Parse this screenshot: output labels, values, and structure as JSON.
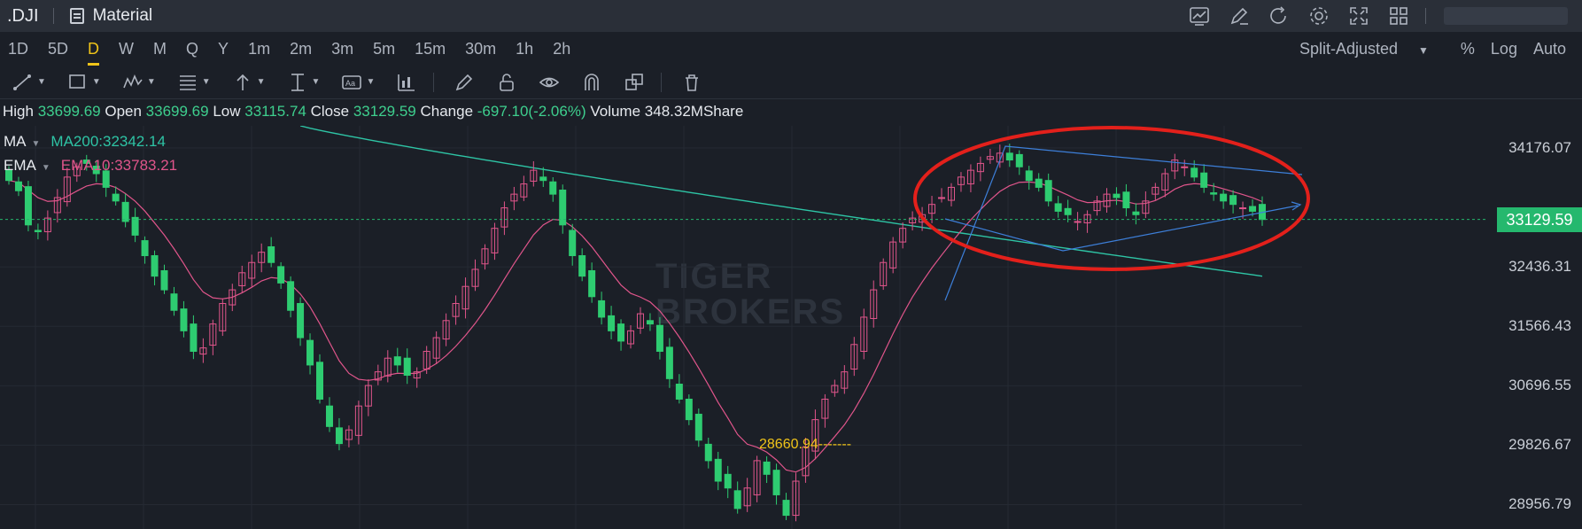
{
  "title_bar": {
    "symbol": ".DJI",
    "layout_name": "Material",
    "icons": [
      "chart-icon",
      "edit-icon",
      "refresh-icon",
      "settings-icon",
      "fullscreen-icon",
      "grid-layout-icon"
    ]
  },
  "periods": [
    "1D",
    "5D",
    "D",
    "W",
    "M",
    "Q",
    "Y",
    "1m",
    "2m",
    "3m",
    "5m",
    "15m",
    "30m",
    "1h",
    "2h"
  ],
  "active_period": "D",
  "options": {
    "adjust": "Split-Adjusted",
    "percent": "%",
    "log": "Log",
    "auto": "Auto"
  },
  "drawing_tools": [
    "line-tool-icon",
    "rectangle-tool-icon",
    "pattern-tool-icon",
    "fibonacci-tool-icon",
    "arrow-tool-icon",
    "measure-tool-icon",
    "text-tool-icon",
    "indicator-tool-icon",
    "pen-icon",
    "lock-icon",
    "eye-icon",
    "magnet-icon",
    "clone-icon",
    "trash-icon"
  ],
  "ohlc": {
    "high_label": "High",
    "high": "33699.69",
    "open_label": "Open",
    "open": "33699.69",
    "low_label": "Low",
    "low": "33115.74",
    "close_label": "Close",
    "close": "33129.59",
    "change_label": "Change",
    "change": "-697.10(-2.06%)",
    "volume_label": "Volume",
    "volume": "348.32MShare"
  },
  "indicators": [
    {
      "name": "MA",
      "value": "MA200:32342.14",
      "color": "#2ec4a5"
    },
    {
      "name": "EMA",
      "value": "EMA10:33783.21",
      "color": "#e0558b"
    }
  ],
  "price_axis": {
    "ticks": [
      "34176.07",
      "32436.31",
      "31566.43",
      "30696.55",
      "29826.67",
      "28956.79"
    ],
    "current_price": "33129.59"
  },
  "low_marker": "28660.94",
  "watermark": [
    "TIGER",
    "BROKERS"
  ],
  "colors": {
    "up": "#e0558b",
    "down": "#2ecc71",
    "ma": "#2ec4a5",
    "ema": "#e0558b",
    "annotation": "#e3201b",
    "trendline": "#3d7fd9",
    "accent": "#f0c419"
  },
  "chart_data": {
    "type": "candlestick",
    "ylim": [
      28600,
      34500
    ],
    "y_ticks": [
      34176.07,
      32436.31,
      31566.43,
      30696.55,
      29826.67,
      28956.79
    ],
    "close_series": [
      33700,
      33550,
      33050,
      32950,
      33150,
      33450,
      33750,
      33900,
      33950,
      33800,
      33600,
      33400,
      33100,
      32900,
      32600,
      32300,
      32100,
      31800,
      31500,
      31200,
      31250,
      31600,
      31900,
      32100,
      32350,
      32500,
      32650,
      32500,
      32200,
      31800,
      31400,
      31000,
      30500,
      30100,
      29850,
      30050,
      30400,
      30700,
      30900,
      31100,
      31000,
      30850,
      30900,
      31200,
      31400,
      31650,
      31900,
      32150,
      32400,
      32700,
      33000,
      33300,
      33500,
      33650,
      33850,
      33700,
      33500,
      33050,
      32600,
      32300,
      32000,
      31700,
      31500,
      31350,
      31500,
      31750,
      31600,
      31200,
      30800,
      30500,
      30200,
      29900,
      29600,
      29300,
      29200,
      28900,
      29200,
      29600,
      29400,
      29100,
      28800,
      29300,
      29800,
      30200,
      30500,
      30700,
      30900,
      31300,
      31700,
      32100,
      32500,
      32800,
      33000,
      33150,
      33200,
      33350,
      33450,
      33600,
      33750,
      33850,
      33950,
      34050,
      34100,
      34000,
      33900,
      33700,
      33600,
      33400,
      33250,
      33200,
      33100,
      33200,
      33400,
      33500,
      33450,
      33300,
      33200,
      33400,
      33600,
      33800,
      34000,
      33900,
      33750,
      33600,
      33500,
      33400,
      33350,
      33300,
      33250,
      33129.59
    ]
  }
}
